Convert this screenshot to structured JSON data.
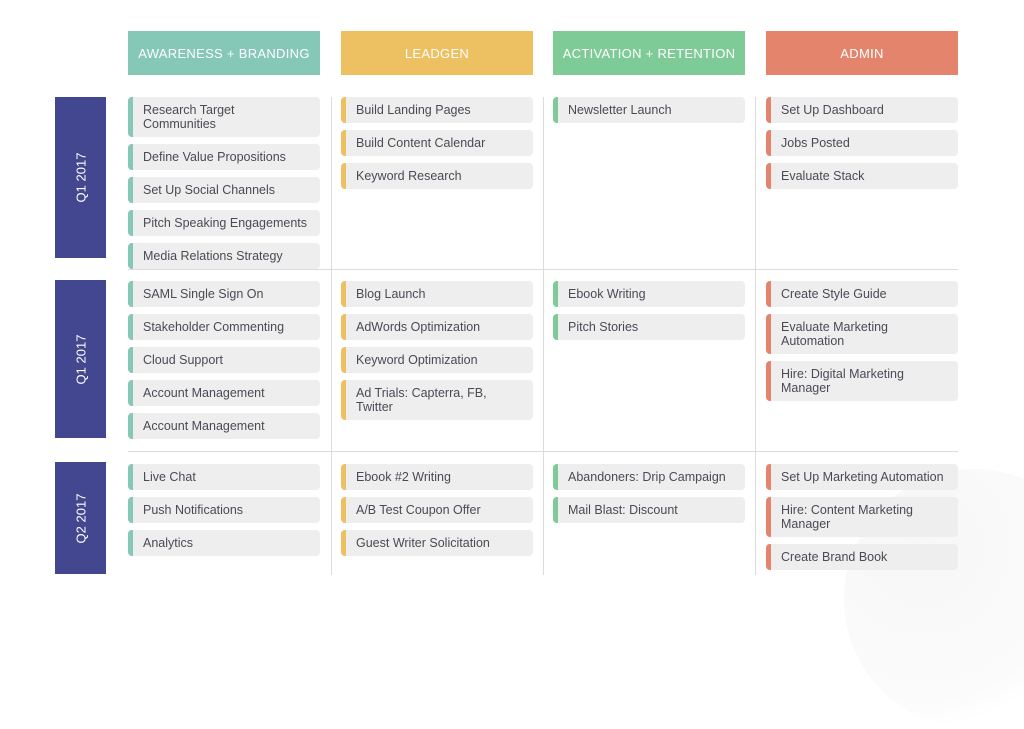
{
  "columns": [
    {
      "label": "AWARENESS + BRANDING",
      "color": "#85c8b8"
    },
    {
      "label": "LEADGEN",
      "color": "#edc062"
    },
    {
      "label": "ACTIVATION + RETENTION",
      "color": "#7fcb98"
    },
    {
      "label": "ADMIN",
      "color": "#e5846c"
    }
  ],
  "row_label_color": "#424790",
  "rows": [
    {
      "label": "Q1 2017",
      "cells": [
        [
          "Research Target Communities",
          "Define Value Propositions",
          "Set Up Social Channels",
          "Pitch Speaking Engagements",
          "Media Relations Strategy"
        ],
        [
          "Build Landing Pages",
          "Build Content Calendar",
          "Keyword Research"
        ],
        [
          "Newsletter Launch"
        ],
        [
          "Set Up Dashboard",
          "Jobs Posted",
          "Evaluate Stack"
        ]
      ]
    },
    {
      "label": "Q1 2017",
      "cells": [
        [
          "SAML Single Sign On",
          "Stakeholder Commenting",
          "Cloud Support",
          "Account Management",
          "Account Management"
        ],
        [
          "Blog Launch",
          "AdWords Optimization",
          "Keyword Optimization",
          "Ad Trials: Capterra, FB, Twitter"
        ],
        [
          "Ebook Writing",
          "Pitch Stories"
        ],
        [
          "Create Style Guide",
          "Evaluate Marketing Automation",
          "Hire: Digital Marketing Manager"
        ]
      ]
    },
    {
      "label": "Q2 2017",
      "cells": [
        [
          "Live Chat",
          "Push Notifications",
          "Analytics"
        ],
        [
          "Ebook #2 Writing",
          "A/B Test Coupon Offer",
          "Guest Writer Solicitation"
        ],
        [
          "Abandoners: Drip Campaign",
          "Mail Blast: Discount"
        ],
        [
          "Set Up Marketing Automation",
          "Hire: Content Marketing Manager",
          "Create Brand Book"
        ]
      ]
    }
  ]
}
